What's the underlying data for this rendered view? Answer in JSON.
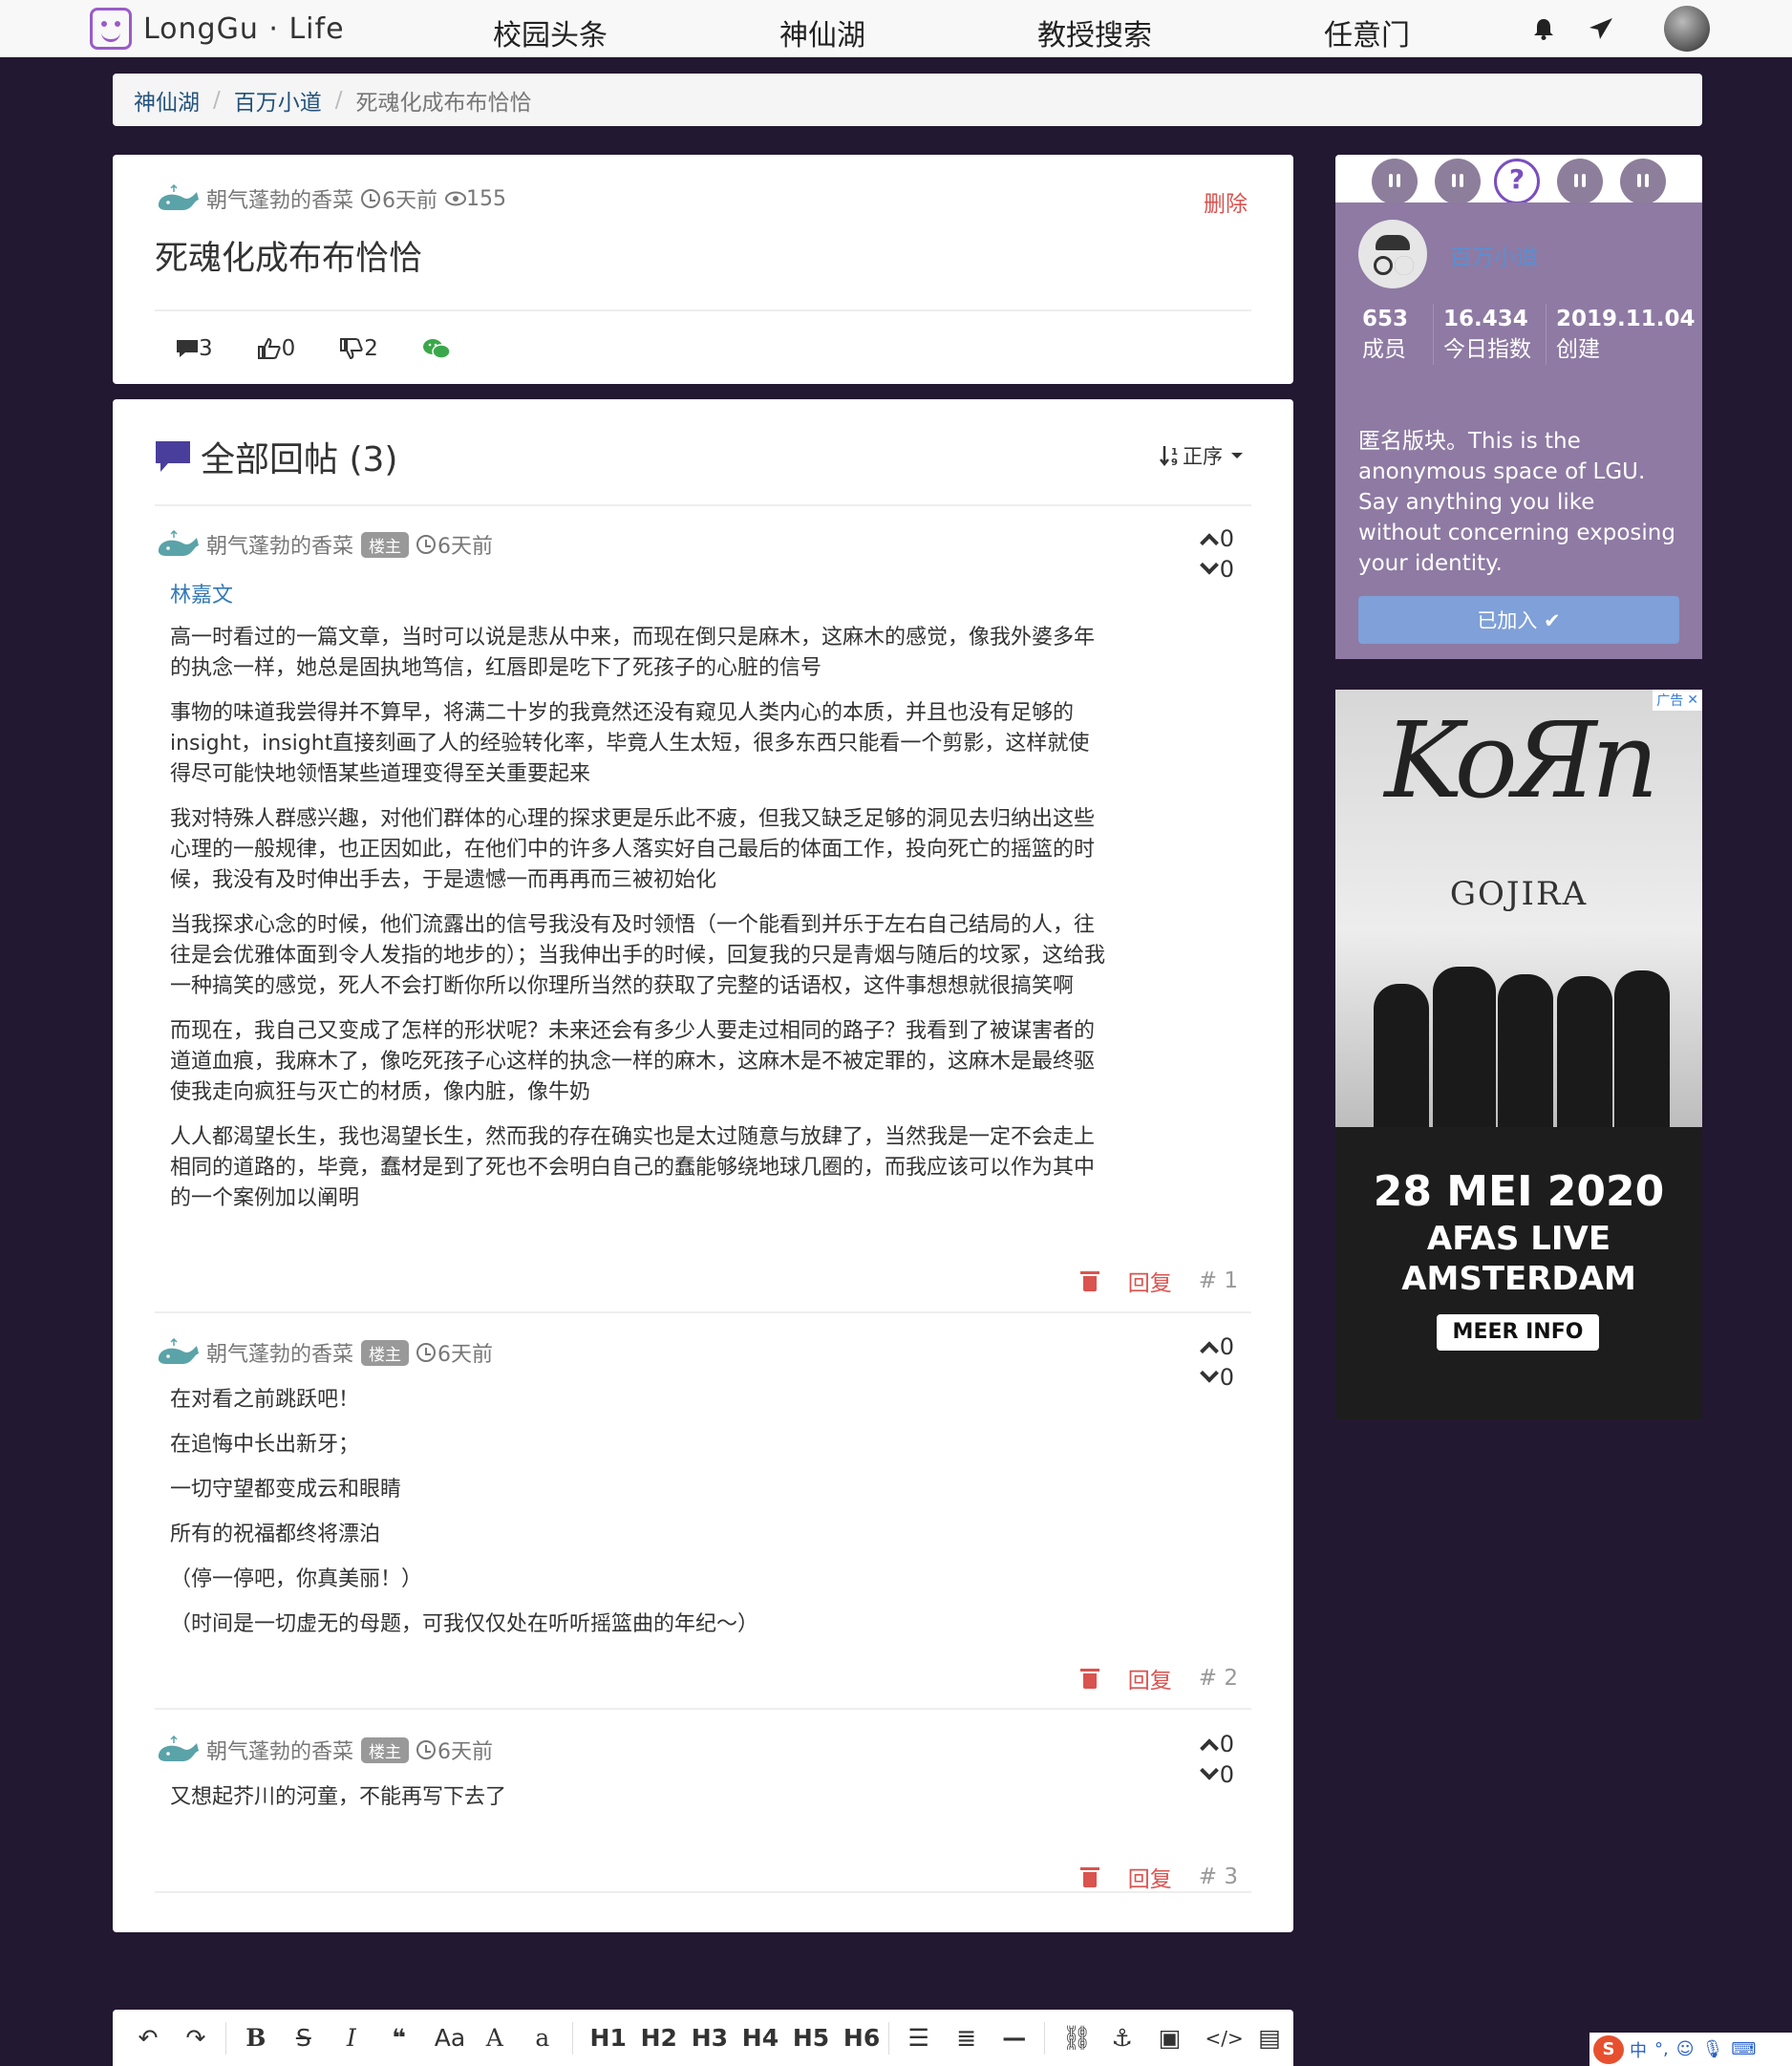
{
  "nav": {
    "logo_text": "LongGu · Life",
    "links": [
      "校园头条",
      "神仙湖",
      "教授搜索",
      "任意门"
    ]
  },
  "breadcrumb": {
    "items": [
      "神仙湖",
      "百万小道"
    ],
    "current": "死魂化成布布恰恰"
  },
  "post": {
    "author": "朝气蓬勃的香菜",
    "time": "6天前",
    "views": "155",
    "delete_label": "删除",
    "title": "死魂化成布布恰恰",
    "comments": "3",
    "likes": "0",
    "dislikes": "2"
  },
  "replies": {
    "title": "全部回帖 (3)",
    "sort_label": "正序",
    "items": [
      {
        "author": "朝气蓬勃的香菜",
        "badge": "楼主",
        "time": "6天前",
        "up": "0",
        "down": "0",
        "mention": "林嘉文",
        "paragraphs": [
          "高一时看过的一篇文章，当时可以说是悲从中来，而现在倒只是麻木，这麻木的感觉，像我外婆多年的执念一样，她总是固执地笃信，红唇即是吃下了死孩子的心脏的信号",
          "事物的味道我尝得并不算早，将满二十岁的我竟然还没有窥见人类内心的本质，并且也没有足够的insight，insight直接刻画了人的经验转化率，毕竟人生太短，很多东西只能看一个剪影，这样就使得尽可能快地领悟某些道理变得至关重要起来",
          "我对特殊人群感兴趣，对他们群体的心理的探求更是乐此不疲，但我又缺乏足够的洞见去归纳出这些心理的一般规律，也正因如此，在他们中的许多人落实好自己最后的体面工作，投向死亡的摇篮的时候，我没有及时伸出手去，于是遗憾一而再再而三被初始化",
          "当我探求心念的时候，他们流露出的信号我没有及时领悟（一个能看到并乐于左右自己结局的人，往往是会优雅体面到令人发指的地步的）；当我伸出手的时候，回复我的只是青烟与随后的坟冢，这给我一种搞笑的感觉，死人不会打断你所以你理所当然的获取了完整的话语权，这件事想想就很搞笑啊",
          "而现在，我自己又变成了怎样的形状呢？未来还会有多少人要走过相同的路子？我看到了被谋害者的道道血痕，我麻木了，像吃死孩子心这样的执念一样的麻木，这麻木是不被定罪的，这麻木是最终驱使我走向疯狂与灭亡的材质，像内脏，像牛奶",
          "人人都渴望长生，我也渴望长生，然而我的存在确实也是太过随意与放肆了，当然我是一定不会走上相同的道路的，毕竟，蠢材是到了死也不会明白自己的蠢能够绕地球几圈的，而我应该可以作为其中的一个案例加以阐明"
        ],
        "reply_label": "回复",
        "floor": "# 1"
      },
      {
        "author": "朝气蓬勃的香菜",
        "badge": "楼主",
        "time": "6天前",
        "up": "0",
        "down": "0",
        "paragraphs": [
          "在对看之前跳跃吧！",
          "在追悔中长出新牙；",
          "一切守望都变成云和眼睛",
          "所有的祝福都终将漂泊",
          "（停一停吧，你真美丽！）",
          "（时间是一切虚无的母题，可我仅仅处在听听摇篮曲的年纪～）"
        ],
        "reply_label": "回复",
        "floor": "# 2"
      },
      {
        "author": "朝气蓬勃的香菜",
        "badge": "楼主",
        "time": "6天前",
        "up": "0",
        "down": "0",
        "paragraphs": [
          "又想起芥川的河童，不能再写下去了"
        ],
        "reply_label": "回复",
        "floor": "# 3"
      }
    ]
  },
  "sidebar": {
    "board_name": "百万小道",
    "stats": [
      {
        "num": "653",
        "label": "成员"
      },
      {
        "num": "16.434",
        "label": "今日指数"
      },
      {
        "num": "2019.11.04",
        "label": "创建"
      }
    ],
    "description": "匿名版块。This is the anonymous space of LGU. Say anything you like without concerning exposing your identity.",
    "joined_label": "已加入 ✔"
  },
  "ad": {
    "tag": "广告",
    "logo": "KoЯn",
    "support": "GOJIRA",
    "date": "28 MEI 2020",
    "venue_line1": "AFAS LIVE",
    "venue_line2": "AMSTERDAM",
    "button": "MEER INFO"
  },
  "toolbar": {
    "undo": "↶",
    "redo": "↷",
    "bold": "B",
    "strike": "S",
    "italic": "I",
    "quote": "❝",
    "case": "Aa",
    "upper": "A",
    "lower": "a",
    "h1": "H1",
    "h2": "H2",
    "h3": "H3",
    "h4": "H4",
    "h5": "H5",
    "h6": "H6",
    "ul": "☰",
    "ol": "≣",
    "hr": "—",
    "link": "⛓",
    "anchor": "⚓",
    "image": "▣",
    "code": "</>",
    "file": "▤"
  },
  "ime": {
    "brand": "S",
    "lang": "中",
    "punct": "°,"
  },
  "colors": {
    "background": "#231831",
    "board_card": "#8e7aa3",
    "danger": "#d9534f",
    "link": "#337ab7"
  }
}
